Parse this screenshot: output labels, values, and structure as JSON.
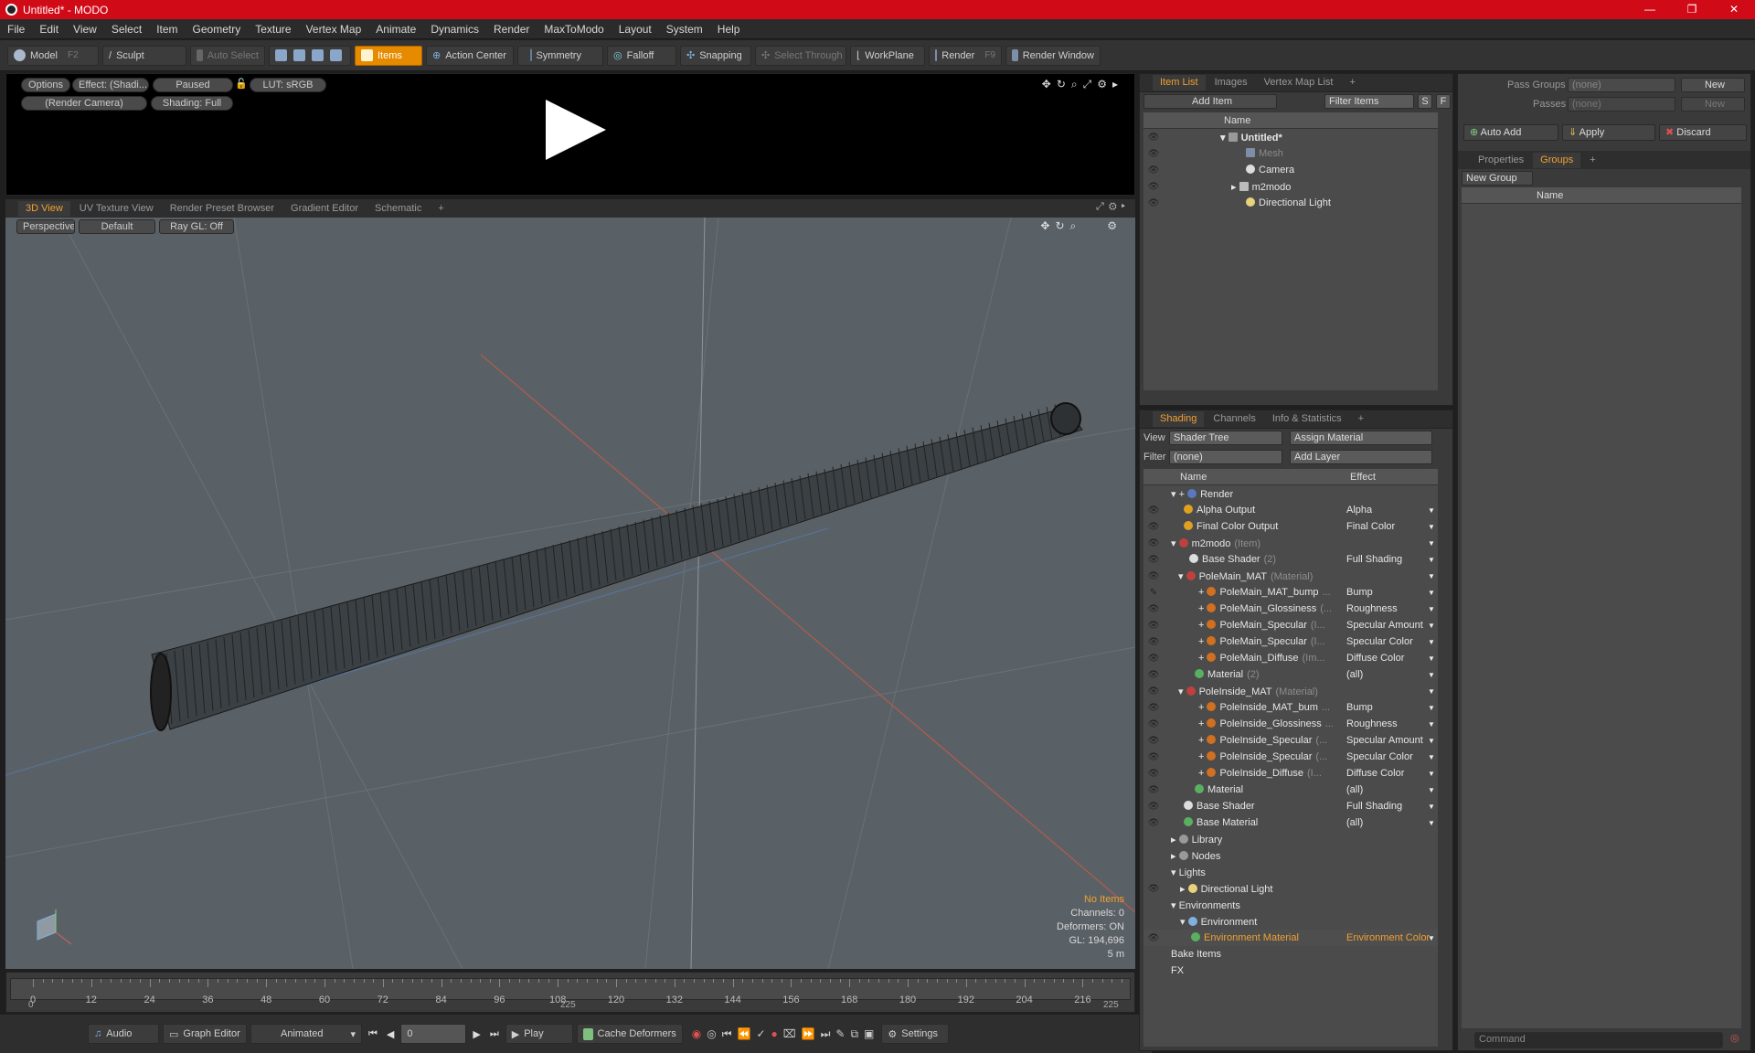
{
  "window": {
    "title": "Untitled* - MODO",
    "controls": [
      "—",
      "❐",
      "✕"
    ]
  },
  "menu": [
    "File",
    "Edit",
    "View",
    "Select",
    "Item",
    "Geometry",
    "Texture",
    "Vertex Map",
    "Animate",
    "Dynamics",
    "Render",
    "MaxToModo",
    "Layout",
    "System",
    "Help"
  ],
  "toolbar": {
    "model": "Model",
    "model_key": "F2",
    "sculpt": "Sculpt",
    "auto_select": "Auto Select",
    "items": "Items",
    "action_center": "Action Center",
    "symmetry": "Symmetry",
    "falloff": "Falloff",
    "snapping": "Snapping",
    "select_through": "Select Through",
    "workplane": "WorkPlane",
    "render": "Render",
    "render_key": "F9",
    "render_window": "Render Window"
  },
  "preview": {
    "options": "Options",
    "effect": "Effect: (Shadi...",
    "paused": "Paused",
    "lut": "LUT: sRGB",
    "camera": "(Render Camera)",
    "shading": "Shading: Full"
  },
  "viewport": {
    "tabs": [
      "3D View",
      "UV Texture View",
      "Render Preset Browser",
      "Gradient Editor",
      "Schematic"
    ],
    "perspective": "Perspective",
    "default": "Default",
    "raygl": "Ray GL: Off",
    "hud": {
      "no_items": "No Items",
      "channels": "Channels: 0",
      "deformers": "Deformers: ON",
      "gl": "GL: 194,696",
      "scale": "5 m"
    }
  },
  "timeline": {
    "ticks": [
      "0",
      "12",
      "24",
      "36",
      "48",
      "60",
      "72",
      "84",
      "96",
      "108",
      "120",
      "132",
      "144",
      "156",
      "168",
      "180",
      "192",
      "204",
      "216"
    ],
    "start": "0",
    "mid": "225",
    "end": "225"
  },
  "bottom": {
    "audio": "Audio",
    "graph_editor": "Graph Editor",
    "animated": "Animated",
    "frame": "0",
    "play": "Play",
    "cache": "Cache Deformers",
    "settings": "Settings"
  },
  "item_list": {
    "tabs": [
      "Item List",
      "Images",
      "Vertex Map List"
    ],
    "add_item": "Add Item",
    "filter": "Filter Items",
    "col_name": "Name",
    "rows": [
      {
        "name": "Untitled*"
      },
      {
        "name": "Mesh"
      },
      {
        "name": "Camera"
      },
      {
        "name": "m2modo"
      },
      {
        "name": "Directional Light"
      }
    ]
  },
  "shading": {
    "tabs": [
      "Shading",
      "Channels",
      "Info & Statistics"
    ],
    "view_label": "View",
    "view_value": "Shader Tree",
    "assign": "Assign Material",
    "filter_label": "Filter",
    "filter_value": "(none)",
    "add_layer": "Add Layer",
    "col_name": "Name",
    "col_effect": "Effect",
    "rows": [
      {
        "name": "Render",
        "sub": "",
        "effect": ""
      },
      {
        "name": "Alpha Output",
        "sub": "",
        "effect": "Alpha"
      },
      {
        "name": "Final Color Output",
        "sub": "",
        "effect": "Final Color"
      },
      {
        "name": "m2modo",
        "sub": "(Item)",
        "effect": ""
      },
      {
        "name": "Base Shader",
        "sub": "(2)",
        "effect": "Full Shading"
      },
      {
        "name": "PoleMain_MAT",
        "sub": "(Material)",
        "effect": ""
      },
      {
        "name": "PoleMain_MAT_bump",
        "sub": "...",
        "effect": "Bump"
      },
      {
        "name": "PoleMain_Glossiness",
        "sub": "(...",
        "effect": "Roughness"
      },
      {
        "name": "PoleMain_Specular",
        "sub": "(I...",
        "effect": "Specular Amount"
      },
      {
        "name": "PoleMain_Specular",
        "sub": "(I...",
        "effect": "Specular Color"
      },
      {
        "name": "PoleMain_Diffuse",
        "sub": "(Im...",
        "effect": "Diffuse Color"
      },
      {
        "name": "Material",
        "sub": "(2)",
        "effect": "(all)"
      },
      {
        "name": "PoleInside_MAT",
        "sub": "(Material)",
        "effect": ""
      },
      {
        "name": "PoleInside_MAT_bum",
        "sub": "...",
        "effect": "Bump"
      },
      {
        "name": "PoleInside_Glossiness",
        "sub": "...",
        "effect": "Roughness"
      },
      {
        "name": "PoleInside_Specular",
        "sub": "(...",
        "effect": "Specular Amount"
      },
      {
        "name": "PoleInside_Specular",
        "sub": "(...",
        "effect": "Specular Color"
      },
      {
        "name": "PoleInside_Diffuse",
        "sub": "(I...",
        "effect": "Diffuse Color"
      },
      {
        "name": "Material",
        "sub": "",
        "effect": "(all)"
      },
      {
        "name": "Base Shader",
        "sub": "",
        "effect": "Full Shading"
      },
      {
        "name": "Base Material",
        "sub": "",
        "effect": "(all)"
      },
      {
        "name": "Library",
        "sub": "",
        "effect": ""
      },
      {
        "name": "Nodes",
        "sub": "",
        "effect": ""
      },
      {
        "name": "Lights",
        "sub": "",
        "effect": ""
      },
      {
        "name": "Directional Light",
        "sub": "",
        "effect": ""
      },
      {
        "name": "Environments",
        "sub": "",
        "effect": ""
      },
      {
        "name": "Environment",
        "sub": "",
        "effect": ""
      },
      {
        "name": "Environment Material",
        "sub": "",
        "effect": "Environment Color"
      },
      {
        "name": "Bake Items",
        "sub": "",
        "effect": ""
      },
      {
        "name": "FX",
        "sub": "",
        "effect": ""
      }
    ]
  },
  "groups": {
    "pass_groups": "Pass Groups",
    "pass_groups_value": "(none)",
    "new1": "New",
    "passes": "Passes",
    "passes_value": "(none)",
    "new2": "New",
    "auto_add": "Auto Add",
    "apply": "Apply",
    "discard": "Discard",
    "tabs": [
      "Properties",
      "Groups"
    ],
    "new_group": "New Group",
    "col_name": "Name"
  },
  "command": {
    "placeholder": "Command"
  }
}
